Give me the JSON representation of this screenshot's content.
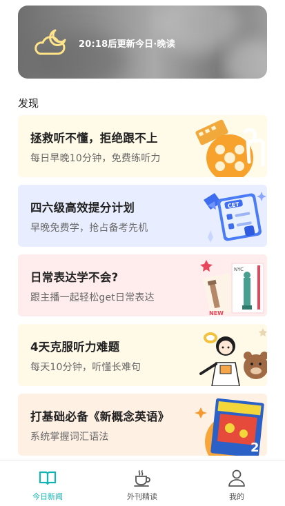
{
  "hero": {
    "text": "20:18后更新今日·晚读",
    "icon": "moon-cloud-icon"
  },
  "section": {
    "title": "发现"
  },
  "cards": [
    {
      "title": "拯救听不懂，拒绝跟不上",
      "subtitle": "每日早晚10分钟，免费练听力",
      "icon": "film-reel-earbuds-icon"
    },
    {
      "title": "四六级高效提分计划",
      "subtitle": "早晚免费学，抢占备考先机",
      "icon": "cet-paper-icon"
    },
    {
      "title": "日常表达学不会?",
      "subtitle": "跟主播一起轻松get日常表达",
      "icon": "travel-tickets-icon"
    },
    {
      "title": "4天克服听力难题",
      "subtitle": "每天10分钟，听懂长难句",
      "icon": "cartoon-girl-bear-icon"
    },
    {
      "title": "打基础必备《新概念英语》",
      "subtitle": "系统掌握词汇语法",
      "icon": "new-concept-book-icon"
    }
  ],
  "tabs": [
    {
      "label": "今日新闻",
      "icon": "open-book-icon",
      "active": true
    },
    {
      "label": "外刊精读",
      "icon": "coffee-cup-icon",
      "active": false
    },
    {
      "label": "我的",
      "icon": "user-profile-icon",
      "active": false
    }
  ],
  "colors": {
    "accent": "#13b4b3",
    "card_1_bg": "#fffbe8",
    "card_2_bg": "#e8eeff",
    "card_3_bg": "#ffecec",
    "card_4_bg": "#fff9e8",
    "card_5_bg": "#fff0e4"
  }
}
